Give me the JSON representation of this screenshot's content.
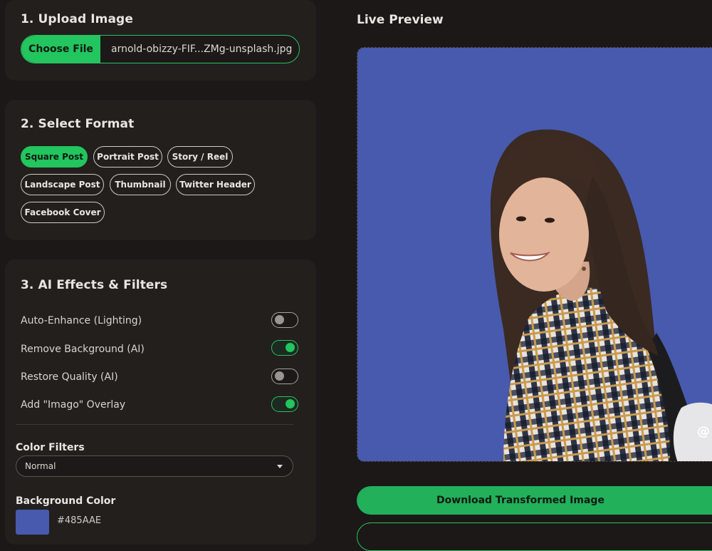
{
  "upload": {
    "title": "1. Upload Image",
    "choose_label": "Choose File",
    "file_name": "arnold-obizzy-FIF...ZMg-unsplash.jpg"
  },
  "format": {
    "title": "2. Select Format",
    "chips": [
      {
        "label": "Square Post",
        "active": true
      },
      {
        "label": "Portrait Post",
        "active": false
      },
      {
        "label": "Story / Reel",
        "active": false
      },
      {
        "label": "Landscape Post",
        "active": false
      },
      {
        "label": "Thumbnail",
        "active": false
      },
      {
        "label": "Twitter Header",
        "active": false
      },
      {
        "label": "Facebook Cover",
        "active": false
      }
    ]
  },
  "effects": {
    "title": "3. AI Effects & Filters",
    "options": [
      {
        "label": "Auto-Enhance (Lighting)",
        "on": false
      },
      {
        "label": "Remove Background (AI)",
        "on": true
      },
      {
        "label": "Restore Quality (AI)",
        "on": false
      },
      {
        "label": "Add \"Imago\" Overlay",
        "on": true
      }
    ],
    "color_filters_title": "Color Filters",
    "color_filter_selected": "Normal",
    "background_color_title": "Background Color",
    "background_color_hex": "#485AAE"
  },
  "preview": {
    "title": "Live Preview",
    "watermark": "@",
    "background_color": "#485AAE"
  },
  "actions": {
    "download_label": "Download Transformed Image"
  },
  "colors": {
    "accent": "#22c55e",
    "page_bg": "#1b1817",
    "card_bg": "#221f1d"
  }
}
